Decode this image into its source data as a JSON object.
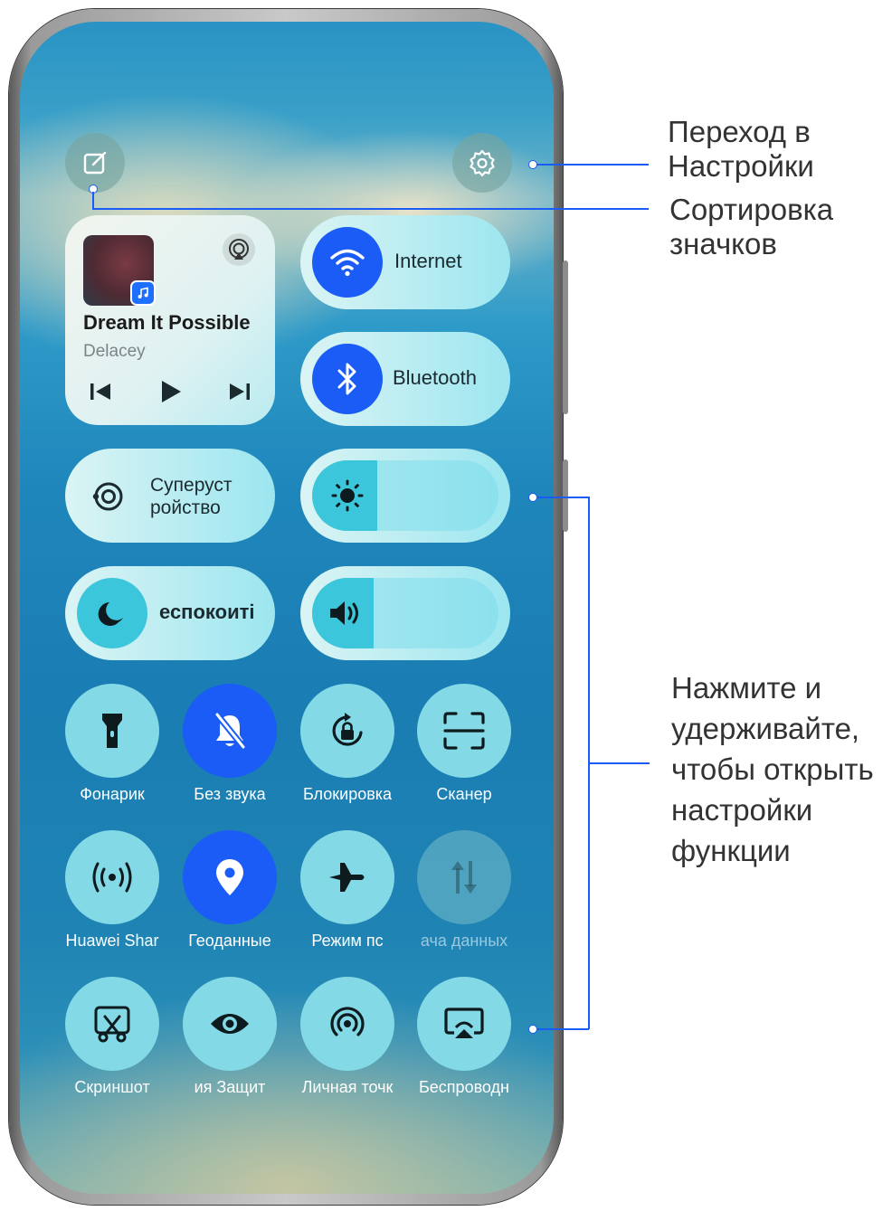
{
  "header": {
    "edit_icon": "edit-icon",
    "settings_icon": "gear-icon"
  },
  "media": {
    "title": "Dream It Possible",
    "artist": "Delacey",
    "controls": [
      "previous-icon",
      "play-icon",
      "next-icon"
    ]
  },
  "toggles": {
    "internet": "Internet",
    "bluetooth": "Bluetooth",
    "super_device": "Суперуст\nройство",
    "dnd": "еспокоиті"
  },
  "sliders": {
    "brightness": 0.35,
    "volume": 0.33
  },
  "tiles": [
    {
      "label": "Фонарик",
      "icon": "flashlight-icon",
      "state": "off"
    },
    {
      "label": "Без звука",
      "icon": "bell-mute-icon",
      "state": "on"
    },
    {
      "label": "Блокировка",
      "icon": "rotation-lock-icon",
      "state": "off"
    },
    {
      "label": "Сканер",
      "icon": "scan-icon",
      "state": "off"
    },
    {
      "label": "Huawei Shar",
      "icon": "share-wave-icon",
      "state": "off"
    },
    {
      "label": "Геоданные",
      "icon": "location-icon",
      "state": "on"
    },
    {
      "label": "Режим пс",
      "icon": "airplane-icon",
      "state": "off"
    },
    {
      "label": "ача данных",
      "icon": "data-transfer-icon",
      "state": "disabled"
    },
    {
      "label": "Скриншот",
      "icon": "screenshot-icon",
      "state": "off"
    },
    {
      "label": "ия    Защит",
      "icon": "eye-icon",
      "state": "off"
    },
    {
      "label": "Личная точк",
      "icon": "hotspot-icon",
      "state": "off"
    },
    {
      "label": "Беспроводн",
      "icon": "wireless-projection-icon",
      "state": "off"
    }
  ],
  "annotations": {
    "settings": "Переход в\nНастройки",
    "sort": "Сортировка\nзначков",
    "hold": "Нажмите и\nудерживайте,\nчтобы открыть\nнастройки\nфункции"
  },
  "colors": {
    "accent": "#1a5cf5",
    "tile": "#83d9e6",
    "annotation_text": "#333333"
  }
}
